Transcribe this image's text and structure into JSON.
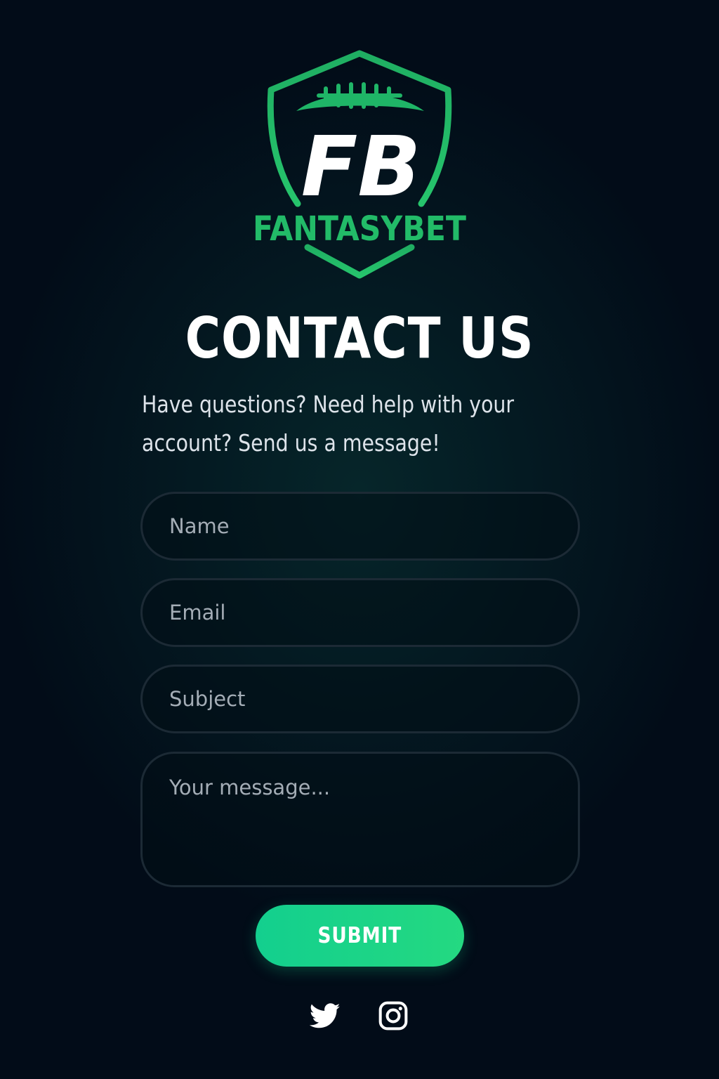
{
  "brand": {
    "monogram": "FB",
    "name": "FANTASYBET",
    "colors": {
      "green": "#1fb567",
      "green_light": "#2ad173",
      "white": "#ffffff"
    }
  },
  "header": {
    "title": "CONTACT US",
    "subtitle_line1": "Have questions? Need help with your",
    "subtitle_line2": "account? Send us a message!"
  },
  "form": {
    "name_placeholder": "Name",
    "email_placeholder": "Email",
    "subject_placeholder": "Subject",
    "message_placeholder": "Your message...",
    "submit_label": "SUBMIT"
  },
  "social": {
    "icons": [
      "twitter-icon",
      "instagram-icon"
    ]
  },
  "colors": {
    "background": "#020c18",
    "accent": "#1ed486",
    "field_border": "#1c2a35"
  }
}
